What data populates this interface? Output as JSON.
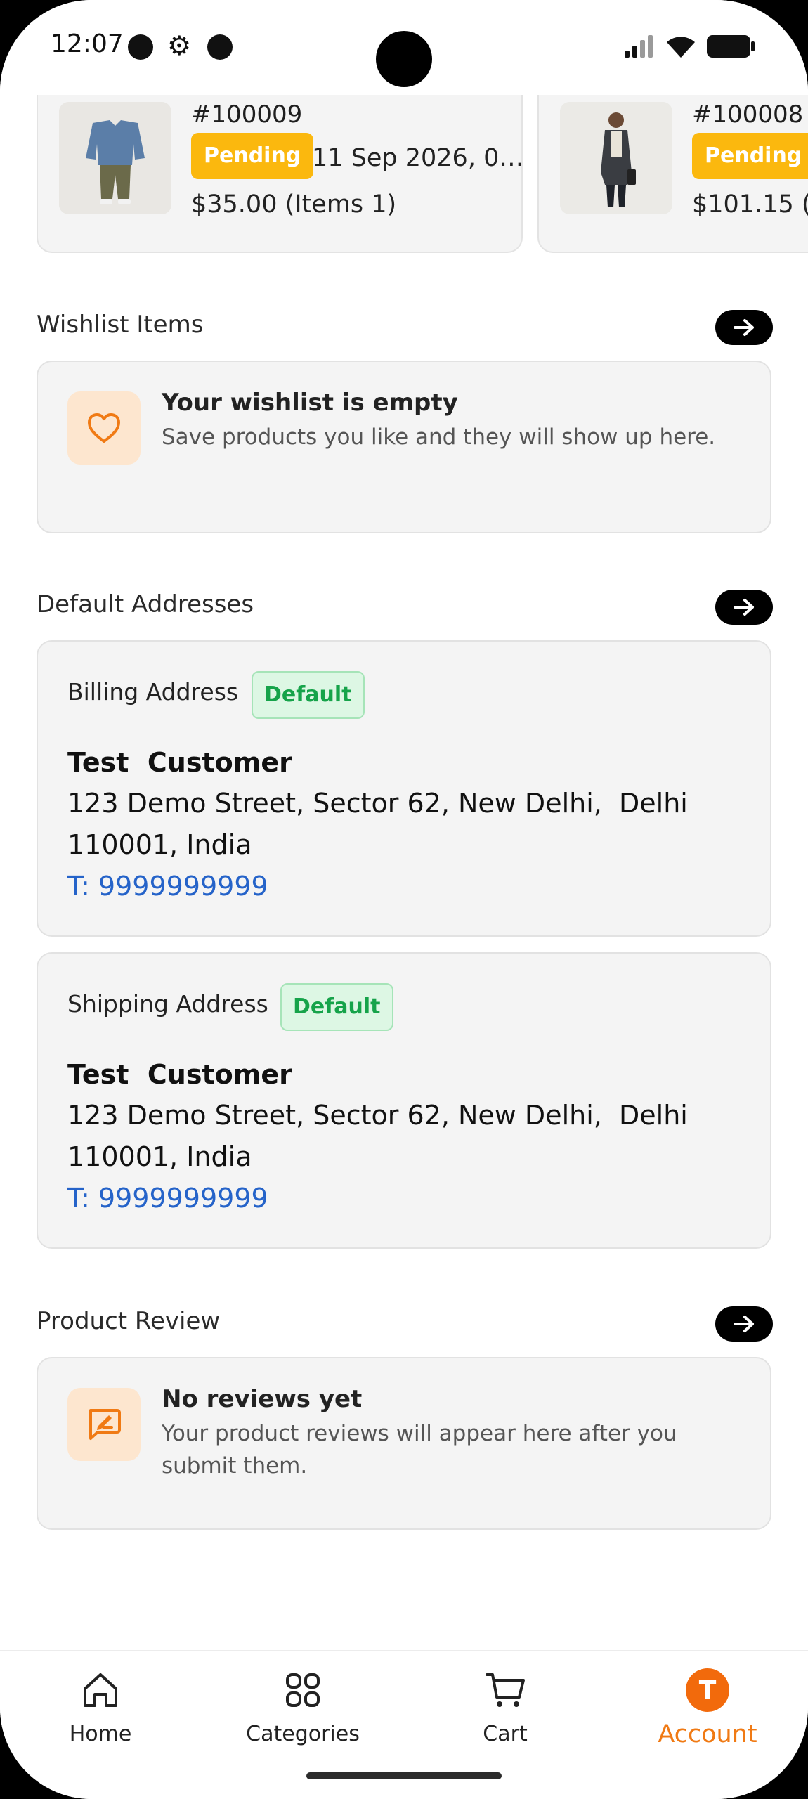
{
  "status_bar": {
    "time": "12:07"
  },
  "orders": [
    {
      "id": "#100009",
      "status": "Pending",
      "date": "11 Sep 2026, 0…",
      "total": "$35.00 (Items 1)"
    },
    {
      "id": "#100008",
      "status": "Pending",
      "date": "",
      "total": "$101.15 (I"
    }
  ],
  "wishlist": {
    "title": "Wishlist Items",
    "empty_title": "Your wishlist is empty",
    "empty_desc": "Save products you like and they will show up here."
  },
  "addresses": {
    "title": "Default Addresses",
    "billing": {
      "label": "Billing Address",
      "badge": "Default",
      "name": "Test  Customer",
      "line1": "123 Demo Street, Sector 62, New Delhi,  Delhi",
      "line2": "110001, India",
      "phone": "T: 9999999999"
    },
    "shipping": {
      "label": "Shipping Address",
      "badge": "Default",
      "name": "Test  Customer",
      "line1": "123 Demo Street, Sector 62, New Delhi,  Delhi",
      "line2": "110001, India",
      "phone": "T: 9999999999"
    }
  },
  "reviews": {
    "title": "Product Review",
    "empty_title": "No reviews yet",
    "empty_desc": "Your product reviews will appear here after you submit them."
  },
  "nav": {
    "home": "Home",
    "categories": "Categories",
    "cart": "Cart",
    "account": "Account",
    "account_initial": "T"
  },
  "colors": {
    "accent": "#f07a14",
    "pending": "#fbb80e",
    "default_green": "#16a34a",
    "link_blue": "#2563c9"
  },
  "icons": {
    "wishlist": "heart-icon",
    "reviews": "review-edit-icon",
    "section_link": "arrow-right-icon"
  }
}
